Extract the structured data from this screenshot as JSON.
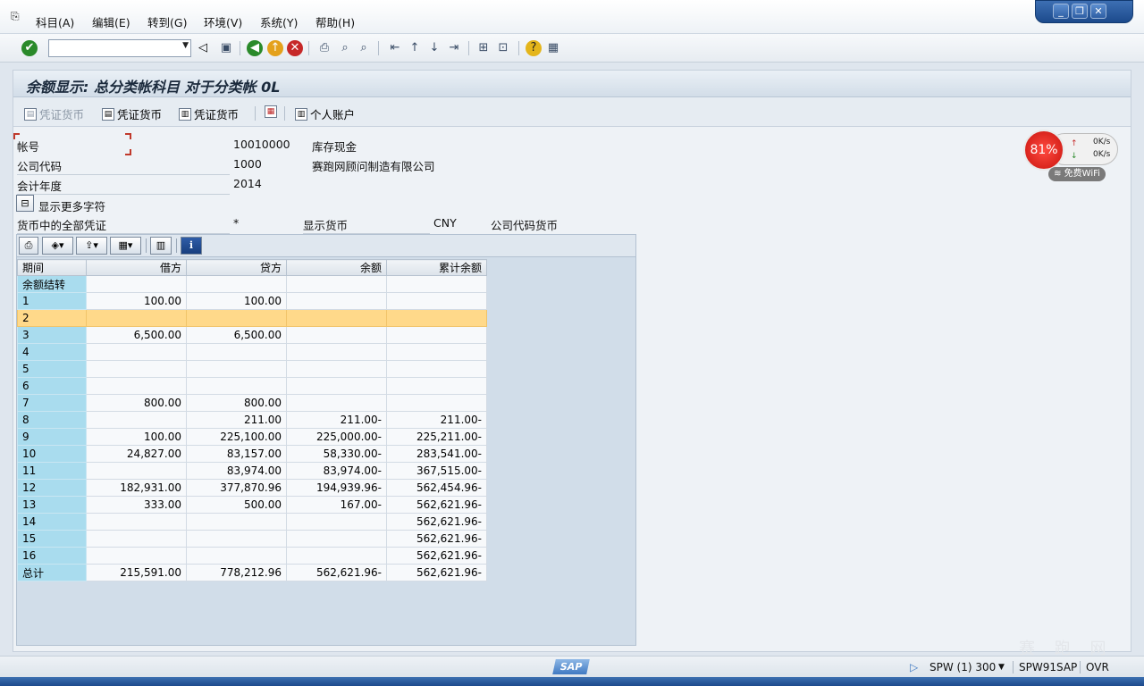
{
  "menu": [
    "科目(A)",
    "编辑(E)",
    "转到(G)",
    "环境(V)",
    "系统(Y)",
    "帮助(H)"
  ],
  "window_controls": {
    "minimize": "_",
    "restore": "❐",
    "close": "✕"
  },
  "command_field": {
    "value": ""
  },
  "title": "余额显示: 总分类帐科目 对于分类帐 0L",
  "app_toolbar": {
    "btn1": "凭证货币",
    "btn2": "凭证货币",
    "btn3": "凭证货币",
    "btn4": "个人账户"
  },
  "form": {
    "account_label": "帐号",
    "account_value": "10010000",
    "account_desc": "库存现金",
    "company_label": "公司代码",
    "company_value": "1000",
    "company_desc": "赛跑网顾问制造有限公司",
    "year_label": "会计年度",
    "year_value": "2014",
    "more_chars": "显示更多字符",
    "all_docs_label": "货币中的全部凭证",
    "all_docs_value": "*",
    "display_currency_label": "显示货币",
    "display_currency_value": "CNY",
    "company_currency_label": "公司代码货币"
  },
  "grid": {
    "columns": [
      "期间",
      "借方",
      "贷方",
      "余额",
      "累计余额"
    ],
    "rows": [
      [
        "余额结转",
        "",
        "",
        "",
        ""
      ],
      [
        "1",
        "100.00",
        "100.00",
        "",
        ""
      ],
      [
        "2",
        "",
        "",
        "",
        ""
      ],
      [
        "3",
        "6,500.00",
        "6,500.00",
        "",
        ""
      ],
      [
        "4",
        "",
        "",
        "",
        ""
      ],
      [
        "5",
        "",
        "",
        "",
        ""
      ],
      [
        "6",
        "",
        "",
        "",
        ""
      ],
      [
        "7",
        "800.00",
        "800.00",
        "",
        ""
      ],
      [
        "8",
        "",
        "211.00",
        "211.00-",
        "211.00-"
      ],
      [
        "9",
        "100.00",
        "225,100.00",
        "225,000.00-",
        "225,211.00-"
      ],
      [
        "10",
        "24,827.00",
        "83,157.00",
        "58,330.00-",
        "283,541.00-"
      ],
      [
        "11",
        "",
        "83,974.00",
        "83,974.00-",
        "367,515.00-"
      ],
      [
        "12",
        "182,931.00",
        "377,870.96",
        "194,939.96-",
        "562,454.96-"
      ],
      [
        "13",
        "333.00",
        "500.00",
        "167.00-",
        "562,621.96-"
      ],
      [
        "14",
        "",
        "",
        "",
        "562,621.96-"
      ],
      [
        "15",
        "",
        "",
        "",
        "562,621.96-"
      ],
      [
        "16",
        "",
        "",
        "",
        "562,621.96-"
      ],
      [
        "总计",
        "215,591.00",
        "778,212.96",
        "562,621.96-",
        "562,621.96-"
      ]
    ],
    "selected_row_index": 2
  },
  "status": {
    "system": "SPW (1) 300",
    "server": "SPW91SAP",
    "mode": "OVR",
    "logo": "SAP"
  },
  "net_widget": {
    "percent": "81%",
    "up": "0K/s",
    "down": "0K/s",
    "wifi": "免费WiFi"
  },
  "watermark": "赛 跑 网"
}
